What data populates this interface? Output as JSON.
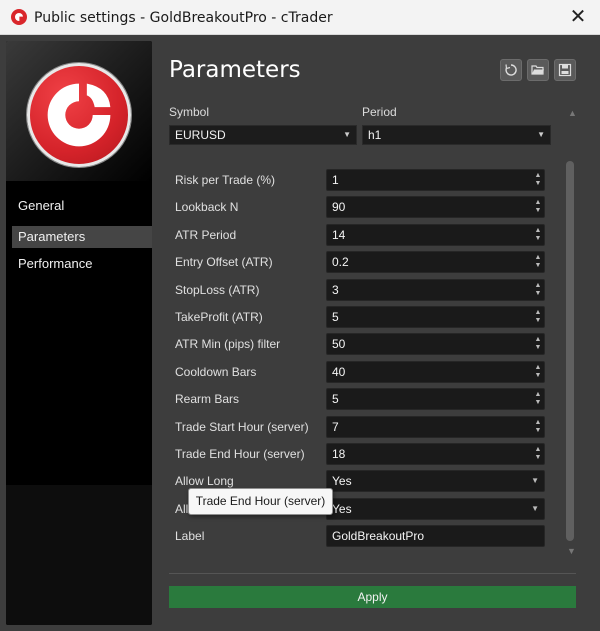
{
  "window": {
    "title": "Public settings - GoldBreakoutPro - cTrader",
    "close_glyph": "✕"
  },
  "sidebar": {
    "logo": "ctrader-logo",
    "items": [
      {
        "label": "General"
      },
      {
        "label": "Parameters",
        "active": true
      },
      {
        "label": "Performance"
      }
    ]
  },
  "header": {
    "title": "Parameters",
    "tools": [
      {
        "icon": "reset-icon"
      },
      {
        "icon": "open-folder-icon"
      },
      {
        "icon": "save-icon"
      }
    ]
  },
  "symbol": {
    "label": "Symbol",
    "value": "EURUSD"
  },
  "period": {
    "label": "Period",
    "value": "h1"
  },
  "params": [
    {
      "label": "Risk per Trade (%)",
      "value": "1",
      "type": "number"
    },
    {
      "label": "Lookback N",
      "value": "90",
      "type": "number"
    },
    {
      "label": "ATR Period",
      "value": "14",
      "type": "number"
    },
    {
      "label": "Entry Offset (ATR)",
      "value": "0.2",
      "type": "number"
    },
    {
      "label": "StopLoss (ATR)",
      "value": "3",
      "type": "number"
    },
    {
      "label": "TakeProfit (ATR)",
      "value": "5",
      "type": "number"
    },
    {
      "label": "ATR Min (pips) filter",
      "value": "50",
      "type": "number"
    },
    {
      "label": "Cooldown Bars",
      "value": "40",
      "type": "number"
    },
    {
      "label": "Rearm Bars",
      "value": "5",
      "type": "number"
    },
    {
      "label": "Trade Start Hour (server)",
      "value": "7",
      "type": "number"
    },
    {
      "label": "Trade End Hour (server)",
      "value": "18",
      "type": "number"
    },
    {
      "label": "Allow Long",
      "value": "Yes",
      "type": "select"
    },
    {
      "label": "Allow Short",
      "value": "Yes",
      "type": "select"
    },
    {
      "label": "Label",
      "value": "GoldBreakoutPro",
      "type": "text"
    }
  ],
  "apply_label": "Apply",
  "tooltip": "Trade End Hour (server)",
  "colors": {
    "apply": "#2a7a3d",
    "brand": "#d9262b",
    "active_nav": "#454545"
  }
}
